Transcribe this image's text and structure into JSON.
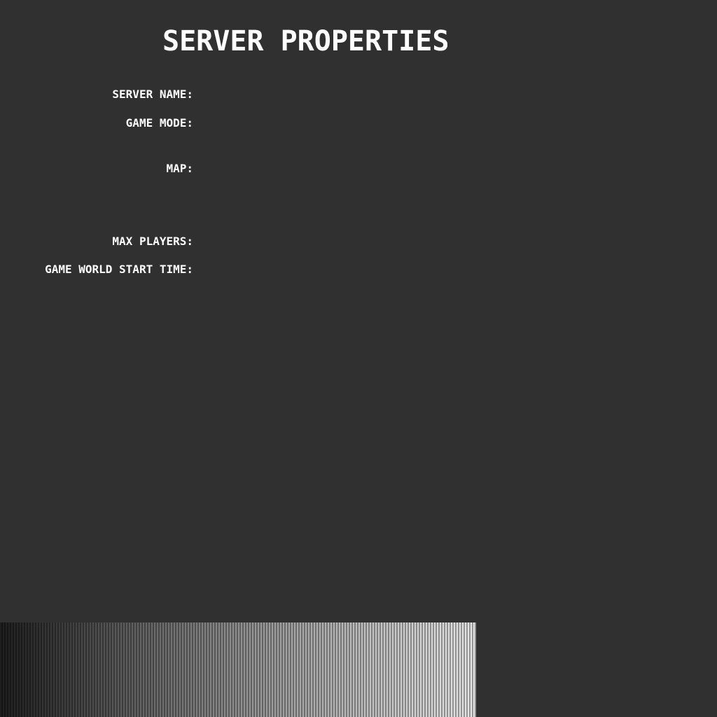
{
  "title": "SERVER PROPERTIES",
  "fields": {
    "server_name": {
      "label": "SERVER NAME:",
      "value": ""
    },
    "game_mode": {
      "label": "GAME MODE:",
      "value": ""
    },
    "map": {
      "label": "MAP:",
      "value": ""
    },
    "max_players": {
      "label": "MAX PLAYERS:",
      "value": ""
    },
    "game_world_start_time": {
      "label": "GAME WORLD START TIME:",
      "value": ""
    }
  },
  "colors": {
    "background": "#303030",
    "text": "#ffffff"
  }
}
